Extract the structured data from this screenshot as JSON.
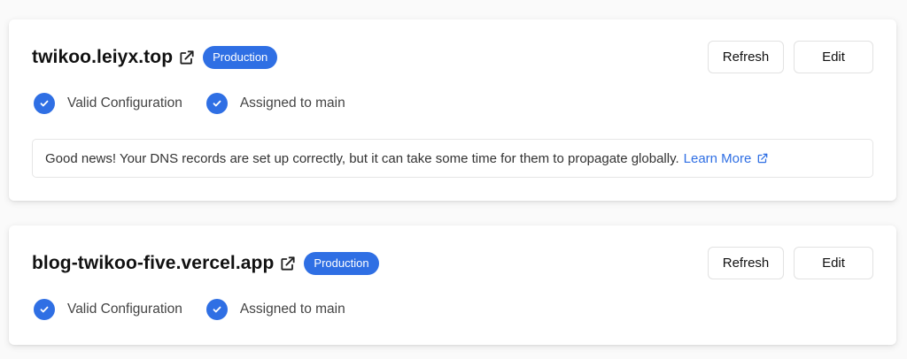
{
  "colors": {
    "accent": "#2f6fe4",
    "text": "#111111",
    "muted": "#444444"
  },
  "cards": [
    {
      "domain": "twikoo.leiyx.top",
      "badge": "Production",
      "refresh_label": "Refresh",
      "edit_label": "Edit",
      "statuses": [
        "Valid Configuration",
        "Assigned to main"
      ],
      "notice": {
        "text": "Good news! Your DNS records are set up correctly, but it can take some time for them to propagate globally.",
        "link_label": "Learn More"
      }
    },
    {
      "domain": "blog-twikoo-five.vercel.app",
      "badge": "Production",
      "refresh_label": "Refresh",
      "edit_label": "Edit",
      "statuses": [
        "Valid Configuration",
        "Assigned to main"
      ]
    }
  ],
  "icons": {
    "external": "external-link-icon",
    "status": "check-circle-icon"
  }
}
